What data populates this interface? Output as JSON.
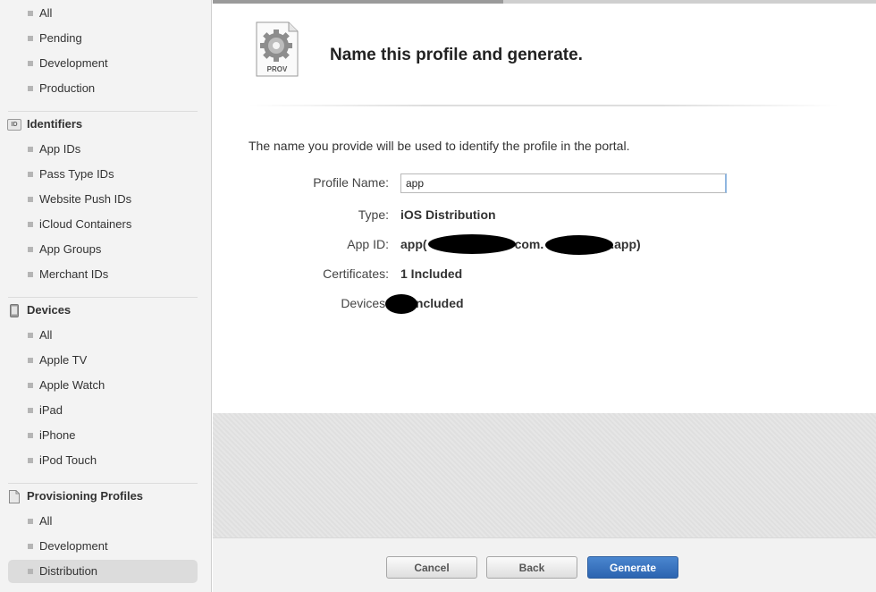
{
  "sidebar": {
    "certificates_items": [
      "All",
      "Pending",
      "Development",
      "Production"
    ],
    "identifiers": {
      "header": "Identifiers",
      "badge": "ID",
      "items": [
        "App IDs",
        "Pass Type IDs",
        "Website Push IDs",
        "iCloud Containers",
        "App Groups",
        "Merchant IDs"
      ]
    },
    "devices": {
      "header": "Devices",
      "items": [
        "All",
        "Apple TV",
        "Apple Watch",
        "iPad",
        "iPhone",
        "iPod Touch"
      ]
    },
    "provisioning": {
      "header": "Provisioning Profiles",
      "items": [
        "All",
        "Development",
        "Distribution"
      ],
      "selected": "Distribution"
    }
  },
  "main": {
    "icon_label": "PROV",
    "title": "Name this profile and generate.",
    "description": "The name you provide will be used to identify the profile in the portal.",
    "form": {
      "profile_name_label": "Profile Name:",
      "profile_name_value": "app",
      "type_label": "Type:",
      "type_value": "iOS Distribution",
      "app_id_label": "App ID:",
      "app_id_value_prefix": "app(",
      "app_id_value_mid": "com.",
      "app_id_value_suffix": ".app)",
      "certificates_label": "Certificates:",
      "certificates_value": "1 Included",
      "devices_label": "Devices:",
      "devices_value": "Included"
    }
  },
  "footer": {
    "cancel_label": "Cancel",
    "back_label": "Back",
    "generate_label": "Generate"
  },
  "colors": {
    "primary_button": "#2c64b0",
    "sidebar_bg": "#f3f3f3",
    "selected_bg": "#dcdcdc"
  }
}
